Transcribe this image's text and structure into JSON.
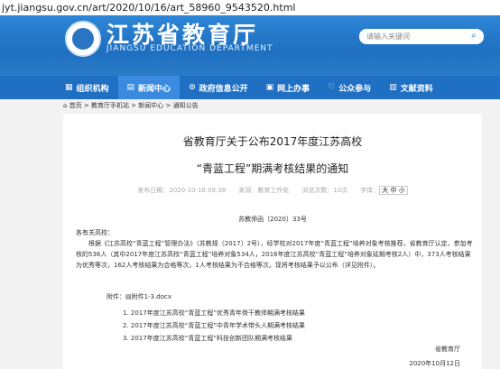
{
  "url": "jyt.jiangsu.gov.cn/art/2020/10/16/art_58960_9543520.html",
  "header": {
    "title": "江苏省教育厅",
    "subtitle": "JIANGSU EDUCATION DEPARTMENT",
    "search_placeholder": "请输入关键词"
  },
  "nav": [
    {
      "label": "组织机构",
      "icon": "building-icon"
    },
    {
      "label": "新闻中心",
      "icon": "news-icon"
    },
    {
      "label": "政府信息公开",
      "icon": "info-icon"
    },
    {
      "label": "网上办事",
      "icon": "service-icon"
    },
    {
      "label": "公众参与",
      "icon": "heart-icon"
    },
    {
      "label": "文献资料",
      "icon": "document-icon"
    }
  ],
  "breadcrumb": "首页 > 教育厅手机站 > 新闻中心 > 通知公告",
  "article": {
    "title_line1": "省教育厅关于公布2017年度江苏高校",
    "title_line2": "“青蓝工程”期满考核结果的通知",
    "date_label": "发布日期：2020-10-16 09:38",
    "source_label": "来源：教育工作处",
    "views_label": "浏览次数：10次",
    "fontsize_label": "字体：",
    "fontsize_value": "大 中 小",
    "doc_number": "苏教师函〔2020〕33号",
    "salutation": "各有关高校：",
    "paragraph": "根据《江苏高校“青蓝工程”管理办法》（苏教规〔2017〕2号），经学校对2017年度“青蓝工程”培养对象考核推荐，省教育厅认定，参加考核的536人（其中2017年度江苏高校“青蓝工程”培养对象534人，2016年度江苏高校“青蓝工程”培养对象延期考核2人）中，373人考核结果为优秀等次，162人考核结果为合格等次，1人考核结果为不合格等次。现将考核结果予以公布（详见附件）。",
    "attachment_label": "附件：",
    "attachment_file": "附件1-3.docx",
    "attachments": [
      "1. 2017年度江苏高校“青蓝工程”优秀青年骨干教师期满考核结果",
      "2. 2017年度江苏高校“青蓝工程”中青年学术带头人期满考核结果",
      "3. 2017年度江苏高校“青蓝工程”科技创新团队期满考核结果"
    ],
    "signature": "省教育厅",
    "sign_date": "2020年10月12日"
  }
}
